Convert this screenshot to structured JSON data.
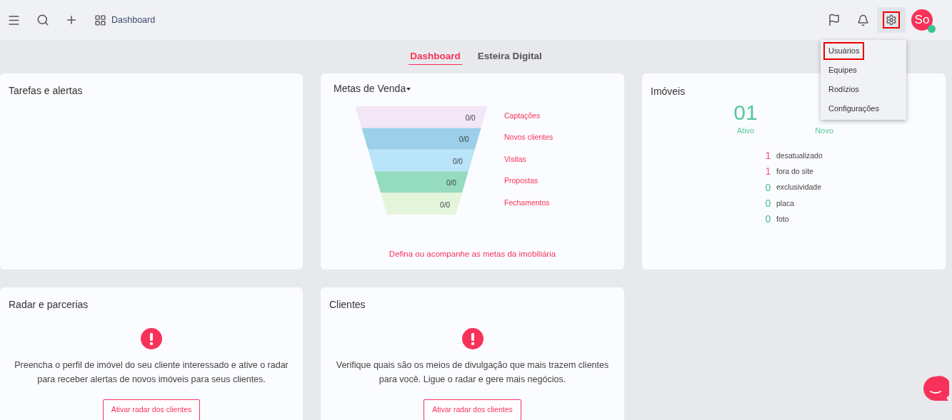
{
  "header": {
    "breadcrumb": "Dashboard",
    "gear_highlighted": true,
    "avatar": "So",
    "online": true
  },
  "settings_menu": {
    "items": [
      {
        "label": "Usuários",
        "highlighted": true
      },
      {
        "label": "Equipes",
        "highlighted": false
      },
      {
        "label": "Rodízios",
        "highlighted": false
      },
      {
        "label": "Configurações",
        "highlighted": false
      }
    ]
  },
  "tabs": [
    {
      "label": "Dashboard",
      "selected": true
    },
    {
      "label": "Esteira Digital",
      "selected": false
    }
  ],
  "tasks": {
    "title": "Tarefas e alertas"
  },
  "sales_goals": {
    "title": "Metas de Venda",
    "stages": [
      {
        "label": "Captações",
        "value": "0/0",
        "color": "#f3e6f6"
      },
      {
        "label": "Novos clientes",
        "value": "0/0",
        "color": "#9ccfea"
      },
      {
        "label": "Visitas",
        "value": "0/0",
        "color": "#b9e4fa"
      },
      {
        "label": "Propostas",
        "value": "0/0",
        "color": "#95dbbf"
      },
      {
        "label": "Fechamentos",
        "value": "0/0",
        "color": "#e4f5dc"
      }
    ],
    "link": "Defina ou acompanhe as metas da imobiliária"
  },
  "properties": {
    "title": "Imóveis",
    "stats": [
      {
        "value": "01",
        "label": "Ativo"
      },
      {
        "label": "Novo"
      }
    ],
    "counts": [
      {
        "count": "1",
        "label": "desatualizado",
        "color": "#f0526e"
      },
      {
        "count": "1",
        "label": "fora do site",
        "color": "#f0526e"
      },
      {
        "count": "0",
        "label": "exclusividade",
        "color": "#3fc08f"
      },
      {
        "count": "0",
        "label": "placa",
        "color": "#3fc08f"
      },
      {
        "count": "0",
        "label": "foto",
        "color": "#3fc08f"
      }
    ]
  },
  "radar": {
    "title": "Radar e parcerias",
    "message": "Preencha o perfil de imóvel do seu cliente interessado e ative o radar para receber alertas de novos imóveis para seus clientes.",
    "button": "Ativar radar dos clientes"
  },
  "clients": {
    "title": "Clientes",
    "message": "Verifique quais são os meios de divulgação que mais trazem clientes para você. Ligue o radar e gere mais negócios.",
    "button": "Ativar radar dos clientes"
  }
}
